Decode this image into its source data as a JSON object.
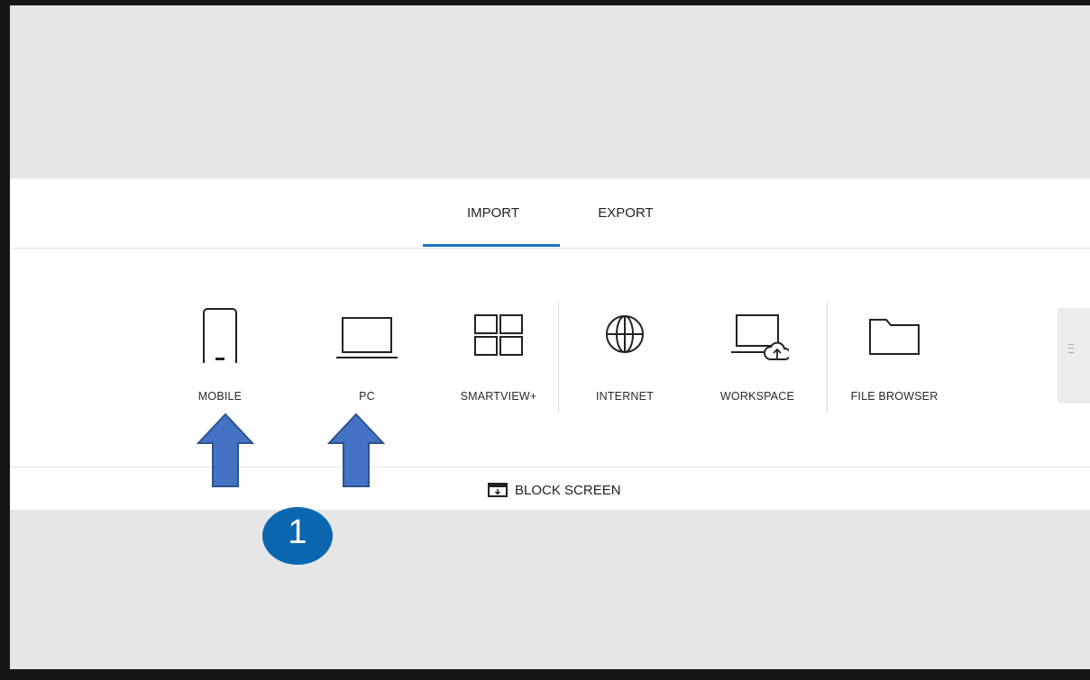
{
  "tabs": {
    "import_label": "IMPORT",
    "export_label": "EXPORT",
    "active": "IMPORT"
  },
  "items": [
    {
      "label": "MOBILE",
      "icon": "mobile-icon"
    },
    {
      "label": "PC",
      "icon": "laptop-icon"
    },
    {
      "label": "SMARTVIEW+",
      "icon": "smartview-grid-icon"
    },
    {
      "label": "INTERNET",
      "icon": "globe-icon"
    },
    {
      "label": "WORKSPACE",
      "icon": "workspace-cloud-laptop-icon"
    },
    {
      "label": "FILE BROWSER",
      "icon": "folder-icon"
    }
  ],
  "footer": {
    "block_screen_label": "BLOCK SCREEN",
    "icon": "block-screen-icon"
  },
  "annotation": {
    "badge_number": "1",
    "badge_color": "#0b67b0",
    "arrow_color": "#4472c4"
  },
  "colors": {
    "accent": "#1a73ba",
    "background": "#e6e6e6",
    "panel": "#ffffff",
    "frame": "#161616"
  }
}
